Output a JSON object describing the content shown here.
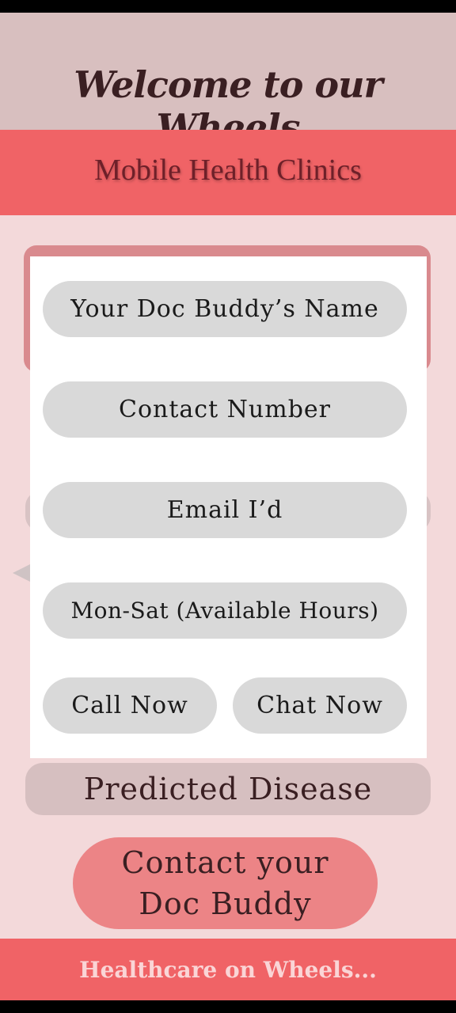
{
  "header": {
    "title": "Welcome to our Wheels"
  },
  "subheader": {
    "title": "Mobile Health Clinics"
  },
  "modal": {
    "name_field": "Your Doc Buddy’s Name",
    "contact_field": "Contact Number",
    "email_field": "Email I’d",
    "hours_field": "Mon-Sat (Available Hours)",
    "call_button": "Call Now",
    "chat_button": "Chat Now"
  },
  "main": {
    "predicted_disease": "Predicted Disease",
    "contact_button": "Contact your Doc Buddy"
  },
  "footer": {
    "tagline": "Healthcare on Wheels..."
  },
  "colors": {
    "header_bg": "#d8bfbf",
    "accent": "#f06366",
    "main_bg": "#f3d9da",
    "pill_bg": "#d9d9d9",
    "contact_button_bg": "#ec8486"
  }
}
